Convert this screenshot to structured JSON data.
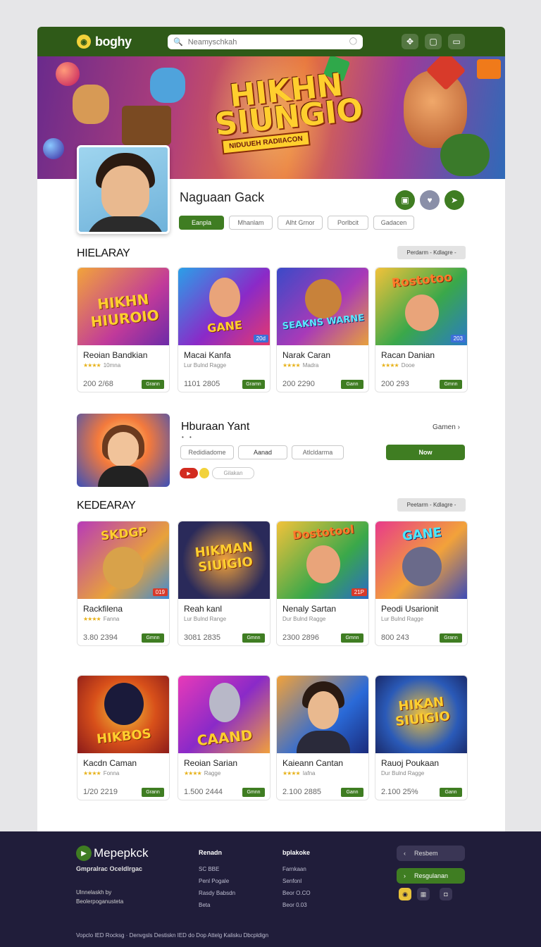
{
  "topbar": {
    "logo_icon": "controller-icon",
    "logo_text": "boghy",
    "search_placeholder": "Neamyschkah",
    "icons": [
      "gamepad-icon",
      "chat-icon",
      "bag-icon"
    ]
  },
  "banner": {
    "title_line1": "HIKHN",
    "title_line2": "SIUNGIO",
    "subtitle": "NIDUUEH RADIIACON"
  },
  "profile": {
    "name": "Naguaan Gack",
    "tabs": [
      "Eanpla",
      "Mhanlam",
      "Alht Grnor",
      "Porlbcit",
      "Gadacen"
    ],
    "action_icons": [
      "gift-icon",
      "heart-icon",
      "share-icon"
    ]
  },
  "section1": {
    "title": "HIELARAY",
    "filter": "Perdarm - Kdlagre -",
    "cards": [
      {
        "thumb_text": "HIKHN HIUROIO",
        "name": "Reoian Bandkian",
        "meta": "10mna",
        "score": "200 2/68",
        "play": "Grann",
        "tag": ""
      },
      {
        "thumb_text": "GANE",
        "name": "Macai Kanfa",
        "meta": "Lur Bulnd Ragge",
        "score": "1101 2805",
        "play": "Gramn",
        "tag": "20d"
      },
      {
        "thumb_text": "SEAKNS WARNE",
        "name": "Narak Caran",
        "meta": "Madra",
        "score": "200 2290",
        "play": "Gann",
        "tag": ""
      },
      {
        "thumb_text": "Rostotoo",
        "name": "Racan Danian",
        "meta": "Dooe",
        "score": "200 293",
        "play": "Gmnn",
        "tag": "203"
      }
    ]
  },
  "feature": {
    "title": "Hburaan Yant",
    "dots": "• •",
    "more": "Gamen",
    "tabs": [
      "Redidiadome",
      "Aanad",
      "Atlcldarma"
    ],
    "tag": "Gilakan",
    "yt_icon": "play-icon",
    "button": "Now"
  },
  "section2": {
    "title": "KEDEARAY",
    "filter": "Peetarm - Kdlagre -",
    "cards": [
      {
        "thumb_text": "SKDGP",
        "name": "Rackfilena",
        "meta": "Fanna",
        "score": "3.80 2394",
        "play": "Gmnn",
        "tag": "019"
      },
      {
        "thumb_text": "HIKMAN SIUIGIO",
        "name": "Reah kanl",
        "meta": "Lur Bulnd Range",
        "score": "3081 2835",
        "play": "Gmnn",
        "tag": ""
      },
      {
        "thumb_text": "Dostotool",
        "name": "Nenaly Sartan",
        "meta": "Dur Bulnd Ragge",
        "score": "2300 2896",
        "play": "Gmnn",
        "tag": "21P"
      },
      {
        "thumb_text": "GANE",
        "name": "Peodi Usarionit",
        "meta": "Lur Bulnd Ragge",
        "score": "800 243",
        "play": "Grann",
        "tag": ""
      }
    ]
  },
  "section3": {
    "cards": [
      {
        "thumb_text": "HIKBOS",
        "name": "Kacdn Caman",
        "meta": "Fonna",
        "score": "1/20 2219",
        "play": "Grann",
        "tag": ""
      },
      {
        "thumb_text": "CAAND",
        "name": "Reoian Sarian",
        "meta": "Ragge",
        "score": "1.500 2444",
        "play": "Gmnn",
        "tag": ""
      },
      {
        "thumb_text": "",
        "name": "Kaieann Cantan",
        "meta": "Iafna",
        "score": "2.100 2885",
        "play": "Gann",
        "tag": ""
      },
      {
        "thumb_text": "HIKAN SIUIGIO",
        "name": "Rauoj Poukaan",
        "meta": "Dur Bulnd Ragge",
        "score": "2.100 25%",
        "play": "Gann",
        "tag": ""
      }
    ]
  },
  "footer": {
    "logo": "Mepepkck",
    "subtitle": "Gmpralrac Oceldlrgac",
    "desc": "Ulnnelaskh by Beolerpoganusteta",
    "col1_title": "Renadn",
    "col1_links": [
      "SC BBE",
      "Penl Pogale",
      "Rasdy Babsdn",
      "Beta"
    ],
    "col2_title": "bplakoke",
    "col2_links": [
      "Farnkaan",
      "Senfonl",
      "Beor O.CO",
      "Beor 0.03"
    ],
    "btn1": "Resbem",
    "btn2": "Resgulanan",
    "social_icons": [
      "coin-icon",
      "grid-icon",
      "camera-icon"
    ],
    "bottom": "Vopclo IED Rocksg · Denvgsls Destiskn IED do Dop Attelg Kalisku Dbcpldign"
  },
  "colors": {
    "brand_green": "#3f7d22",
    "topbar": "#2f5a18",
    "footer": "#201d3a",
    "star": "#e7b21b"
  }
}
